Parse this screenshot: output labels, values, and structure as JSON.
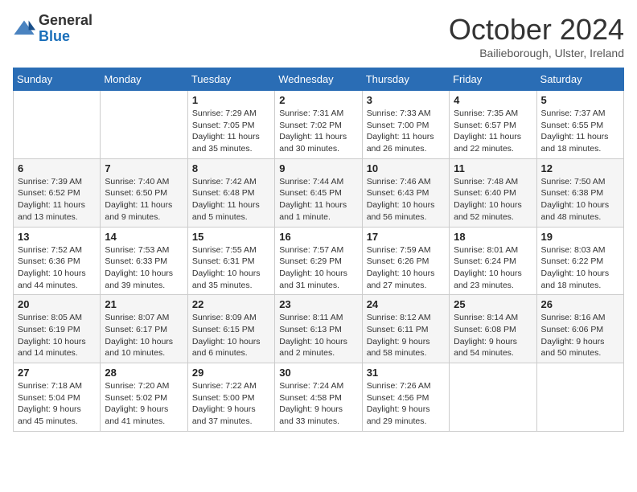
{
  "header": {
    "logo_general": "General",
    "logo_blue": "Blue",
    "month_title": "October 2024",
    "location": "Bailieborough, Ulster, Ireland"
  },
  "weekdays": [
    "Sunday",
    "Monday",
    "Tuesday",
    "Wednesday",
    "Thursday",
    "Friday",
    "Saturday"
  ],
  "weeks": [
    [
      {
        "day": "",
        "info": ""
      },
      {
        "day": "",
        "info": ""
      },
      {
        "day": "1",
        "info": "Sunrise: 7:29 AM\nSunset: 7:05 PM\nDaylight: 11 hours and 35 minutes."
      },
      {
        "day": "2",
        "info": "Sunrise: 7:31 AM\nSunset: 7:02 PM\nDaylight: 11 hours and 30 minutes."
      },
      {
        "day": "3",
        "info": "Sunrise: 7:33 AM\nSunset: 7:00 PM\nDaylight: 11 hours and 26 minutes."
      },
      {
        "day": "4",
        "info": "Sunrise: 7:35 AM\nSunset: 6:57 PM\nDaylight: 11 hours and 22 minutes."
      },
      {
        "day": "5",
        "info": "Sunrise: 7:37 AM\nSunset: 6:55 PM\nDaylight: 11 hours and 18 minutes."
      }
    ],
    [
      {
        "day": "6",
        "info": "Sunrise: 7:39 AM\nSunset: 6:52 PM\nDaylight: 11 hours and 13 minutes."
      },
      {
        "day": "7",
        "info": "Sunrise: 7:40 AM\nSunset: 6:50 PM\nDaylight: 11 hours and 9 minutes."
      },
      {
        "day": "8",
        "info": "Sunrise: 7:42 AM\nSunset: 6:48 PM\nDaylight: 11 hours and 5 minutes."
      },
      {
        "day": "9",
        "info": "Sunrise: 7:44 AM\nSunset: 6:45 PM\nDaylight: 11 hours and 1 minute."
      },
      {
        "day": "10",
        "info": "Sunrise: 7:46 AM\nSunset: 6:43 PM\nDaylight: 10 hours and 56 minutes."
      },
      {
        "day": "11",
        "info": "Sunrise: 7:48 AM\nSunset: 6:40 PM\nDaylight: 10 hours and 52 minutes."
      },
      {
        "day": "12",
        "info": "Sunrise: 7:50 AM\nSunset: 6:38 PM\nDaylight: 10 hours and 48 minutes."
      }
    ],
    [
      {
        "day": "13",
        "info": "Sunrise: 7:52 AM\nSunset: 6:36 PM\nDaylight: 10 hours and 44 minutes."
      },
      {
        "day": "14",
        "info": "Sunrise: 7:53 AM\nSunset: 6:33 PM\nDaylight: 10 hours and 39 minutes."
      },
      {
        "day": "15",
        "info": "Sunrise: 7:55 AM\nSunset: 6:31 PM\nDaylight: 10 hours and 35 minutes."
      },
      {
        "day": "16",
        "info": "Sunrise: 7:57 AM\nSunset: 6:29 PM\nDaylight: 10 hours and 31 minutes."
      },
      {
        "day": "17",
        "info": "Sunrise: 7:59 AM\nSunset: 6:26 PM\nDaylight: 10 hours and 27 minutes."
      },
      {
        "day": "18",
        "info": "Sunrise: 8:01 AM\nSunset: 6:24 PM\nDaylight: 10 hours and 23 minutes."
      },
      {
        "day": "19",
        "info": "Sunrise: 8:03 AM\nSunset: 6:22 PM\nDaylight: 10 hours and 18 minutes."
      }
    ],
    [
      {
        "day": "20",
        "info": "Sunrise: 8:05 AM\nSunset: 6:19 PM\nDaylight: 10 hours and 14 minutes."
      },
      {
        "day": "21",
        "info": "Sunrise: 8:07 AM\nSunset: 6:17 PM\nDaylight: 10 hours and 10 minutes."
      },
      {
        "day": "22",
        "info": "Sunrise: 8:09 AM\nSunset: 6:15 PM\nDaylight: 10 hours and 6 minutes."
      },
      {
        "day": "23",
        "info": "Sunrise: 8:11 AM\nSunset: 6:13 PM\nDaylight: 10 hours and 2 minutes."
      },
      {
        "day": "24",
        "info": "Sunrise: 8:12 AM\nSunset: 6:11 PM\nDaylight: 9 hours and 58 minutes."
      },
      {
        "day": "25",
        "info": "Sunrise: 8:14 AM\nSunset: 6:08 PM\nDaylight: 9 hours and 54 minutes."
      },
      {
        "day": "26",
        "info": "Sunrise: 8:16 AM\nSunset: 6:06 PM\nDaylight: 9 hours and 50 minutes."
      }
    ],
    [
      {
        "day": "27",
        "info": "Sunrise: 7:18 AM\nSunset: 5:04 PM\nDaylight: 9 hours and 45 minutes."
      },
      {
        "day": "28",
        "info": "Sunrise: 7:20 AM\nSunset: 5:02 PM\nDaylight: 9 hours and 41 minutes."
      },
      {
        "day": "29",
        "info": "Sunrise: 7:22 AM\nSunset: 5:00 PM\nDaylight: 9 hours and 37 minutes."
      },
      {
        "day": "30",
        "info": "Sunrise: 7:24 AM\nSunset: 4:58 PM\nDaylight: 9 hours and 33 minutes."
      },
      {
        "day": "31",
        "info": "Sunrise: 7:26 AM\nSunset: 4:56 PM\nDaylight: 9 hours and 29 minutes."
      },
      {
        "day": "",
        "info": ""
      },
      {
        "day": "",
        "info": ""
      }
    ]
  ]
}
